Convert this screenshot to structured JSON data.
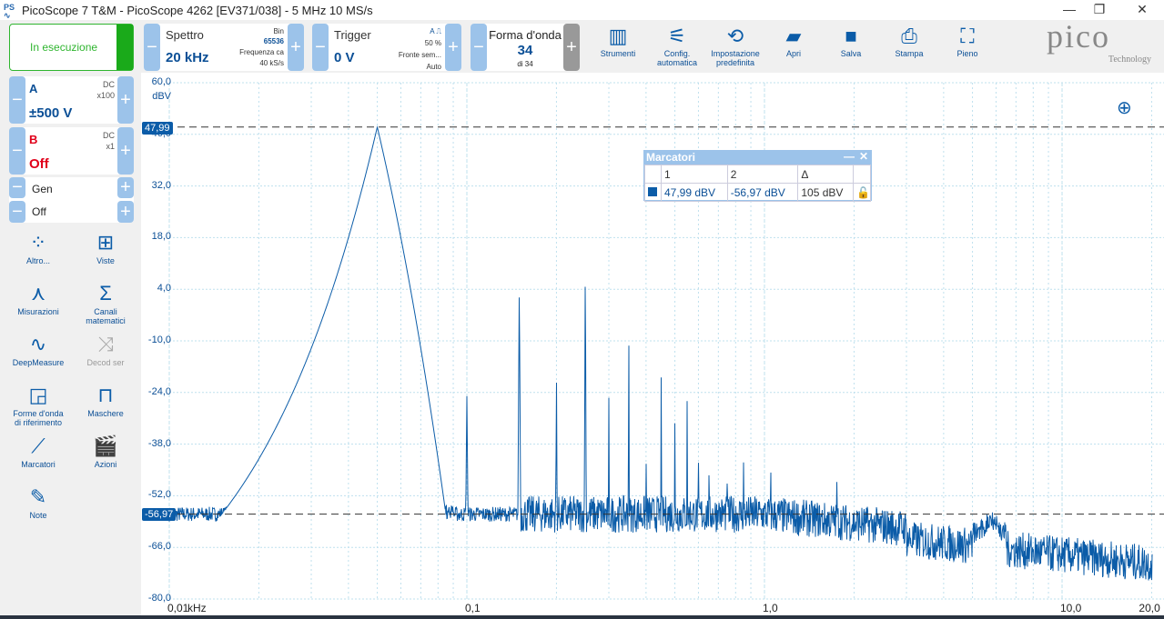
{
  "window": {
    "title": "PicoScope 7 T&M  - PicoScope 4262 [EV371/038] - 5 MHz 10 MS/s",
    "minimize": "—",
    "maximize": "❐",
    "close": "✕"
  },
  "toolbar": {
    "run_status": "In esecuzione",
    "spectrum": {
      "label": "Spettro",
      "value": "20 kHz",
      "bin_label": "Bin",
      "bins": "65536",
      "freq_label": "Frequenza ca",
      "rate": "40 kS/s"
    },
    "trigger": {
      "label": "Trigger",
      "value": "0 V",
      "channel": "A",
      "level": "50 %",
      "edge": "Fronte sem...",
      "mode": "Auto"
    },
    "waveform": {
      "label": "Forma d'onda",
      "value": "34",
      "of": "di 34"
    },
    "tools": [
      {
        "label": "Strumenti",
        "icon": "instruments-icon"
      },
      {
        "label": "Config. automatica",
        "icon": "auto-setup-icon"
      },
      {
        "label": "Impostazione predefinita",
        "icon": "default-setup-icon"
      },
      {
        "label": "Apri",
        "icon": "folder-icon"
      },
      {
        "label": "Salva",
        "icon": "save-icon"
      },
      {
        "label": "Stampa",
        "icon": "print-icon"
      },
      {
        "label": "Pieno",
        "icon": "fullscreen-icon"
      }
    ],
    "logo": {
      "text": "pico",
      "sub": "Technology"
    }
  },
  "channels": {
    "a": {
      "name": "A",
      "coupling": "DC",
      "probe": "x100",
      "range": "±500 V"
    },
    "b": {
      "name": "B",
      "coupling": "DC",
      "probe": "x1",
      "range": "Off"
    },
    "gen": {
      "label": "Gen",
      "value": "Off"
    }
  },
  "sidebar": [
    {
      "label": "Altro...",
      "icon": "more-icon"
    },
    {
      "label": "Viste",
      "icon": "views-icon"
    },
    {
      "label": "Misurazioni",
      "icon": "measurements-icon"
    },
    {
      "label": "Canali matematici",
      "icon": "math-channels-icon"
    },
    {
      "label": "DeepMeasure",
      "icon": "deepmeasure-icon"
    },
    {
      "label": "Decod ser",
      "icon": "serial-decode-icon",
      "disabled": true
    },
    {
      "label": "Forme d'onda di riferimento",
      "icon": "reference-waveforms-icon"
    },
    {
      "label": "Maschere",
      "icon": "masks-icon"
    },
    {
      "label": "Marcatori",
      "icon": "rulers-icon"
    },
    {
      "label": "Azioni",
      "icon": "actions-icon"
    },
    {
      "label": "Note",
      "icon": "notes-icon"
    }
  ],
  "markers": {
    "title": "Marcatori",
    "headers": [
      "1",
      "2",
      "Δ"
    ],
    "values": [
      "47,99 dBV",
      "-56,97 dBV",
      "105 dBV"
    ],
    "marker1_tag": "47,99",
    "marker2_tag": "-56,97"
  },
  "chart_data": {
    "type": "line",
    "xlabel": "kHz",
    "ylabel": "dBV",
    "xscale": "log",
    "xlim": [
      0.01,
      20
    ],
    "ylim": [
      -80,
      60
    ],
    "xticks": [
      "0,01",
      "0,1",
      "1,0",
      "10,0",
      "20,0"
    ],
    "yticks": [
      "60,0",
      "46,0",
      "32,0",
      "18,0",
      "4,0",
      "-10,0",
      "-24,0",
      "-38,0",
      "-52,0",
      "-66,0",
      "-80,0"
    ],
    "grid": true,
    "series_color": "#0b5ca8",
    "noise_floor_dBV": -57,
    "harmonics_kHz": [
      0.05,
      0.1,
      0.15,
      0.2,
      0.25,
      0.3,
      0.35,
      0.4,
      0.45,
      0.5,
      0.55,
      0.6,
      0.65,
      0.7,
      0.75,
      0.85,
      0.95,
      1.05,
      1.15,
      1.25,
      1.35,
      1.45,
      1.55,
      1.75,
      1.95,
      2.15,
      2.35,
      2.55,
      2.75,
      3.05,
      3.35,
      3.65,
      3.95,
      4.35,
      4.75,
      5.25,
      5.75,
      6.25,
      7.0,
      7.5,
      8.5,
      10.5,
      18.5
    ],
    "harmonics_dBV": [
      47.99,
      -25,
      5,
      -18,
      13,
      -24,
      -3,
      -30,
      -8,
      -24,
      -12,
      -36,
      -16,
      -28,
      -20,
      -25,
      -25,
      -26,
      -28,
      -30,
      -32,
      -35,
      -33,
      -36,
      -38,
      -36,
      -38,
      -40,
      -42,
      -40,
      -44,
      -42,
      -46,
      -45,
      -44,
      -50,
      -46,
      -52,
      -48,
      -54,
      -60,
      -44,
      -52
    ],
    "horizontal_markers_dBV": [
      47.99,
      -56.97
    ]
  }
}
